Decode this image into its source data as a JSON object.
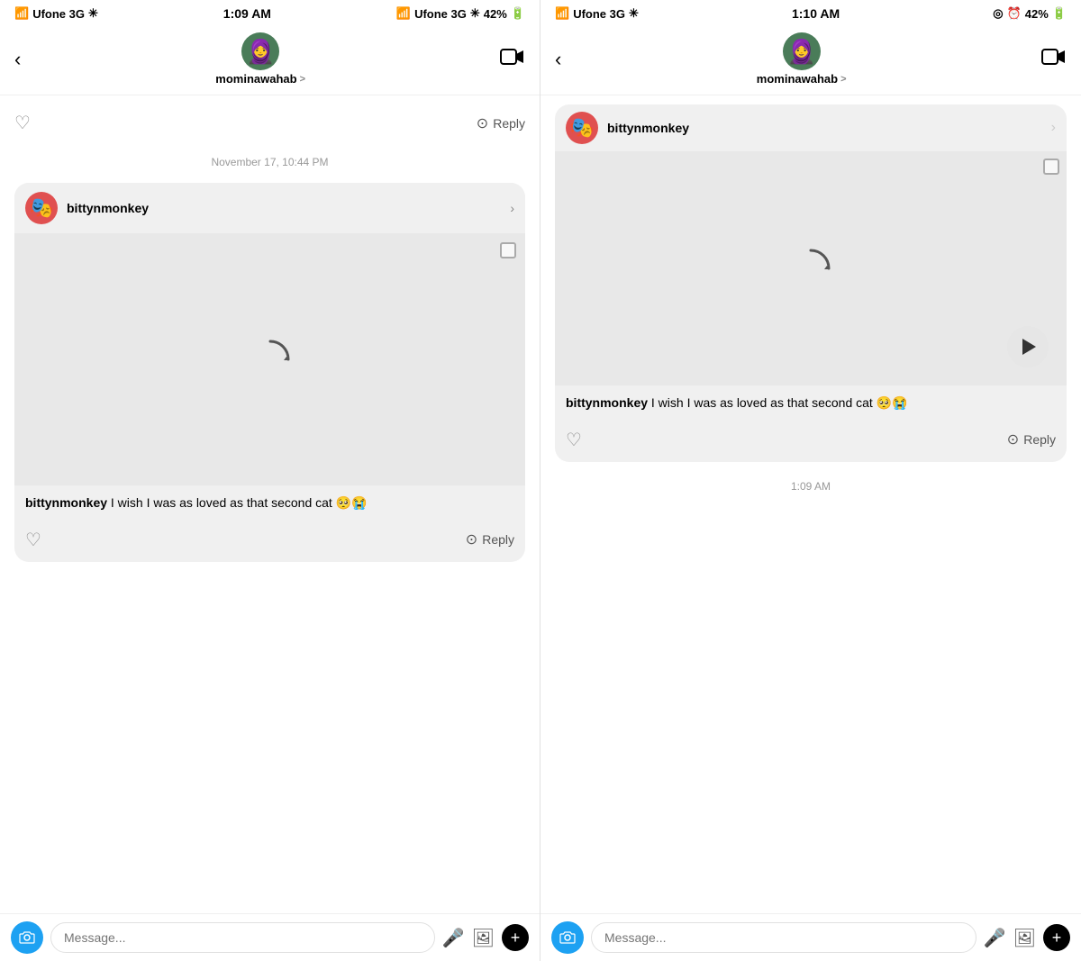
{
  "left_panel": {
    "status_bar": {
      "carrier": "Ufone  3G",
      "time": "1:09 AM",
      "battery": "42%"
    },
    "nav": {
      "username": "mominawahab",
      "chevron": ">"
    },
    "prev_message_actions": {
      "heart": "♡",
      "reply_label": "Reply"
    },
    "timestamp": "November 17, 10:44 PM",
    "story_card": {
      "username": "bittynmonkey",
      "message_text": " I wish I was as loved as that second cat 🥺😭",
      "reply_label": "Reply"
    },
    "input": {
      "placeholder": "Message...",
      "camera_icon": "📷",
      "mic_icon": "🎤",
      "gallery_icon": "🖼",
      "plus_icon": "+"
    }
  },
  "right_panel": {
    "status_bar": {
      "carrier": "Ufone  3G",
      "time": "1:10 AM",
      "battery": "42%"
    },
    "nav": {
      "username": "mominawahab",
      "chevron": ">"
    },
    "top_card": {
      "username": "bittynmonkey",
      "chevron": "›"
    },
    "story_card": {
      "username": "bittynmonkey",
      "message_text": " I wish I was as loved as that second cat 🥺😭",
      "reply_label": "Reply"
    },
    "timestamp": "1:09 AM",
    "input": {
      "placeholder": "Message...",
      "camera_icon": "📷",
      "mic_icon": "🎤",
      "gallery_icon": "🖼",
      "plus_icon": "+"
    }
  },
  "icons": {
    "back": "‹",
    "video": "□▷",
    "heart": "♡",
    "camera": "⊙",
    "spinner": "↻",
    "play": "▶"
  }
}
